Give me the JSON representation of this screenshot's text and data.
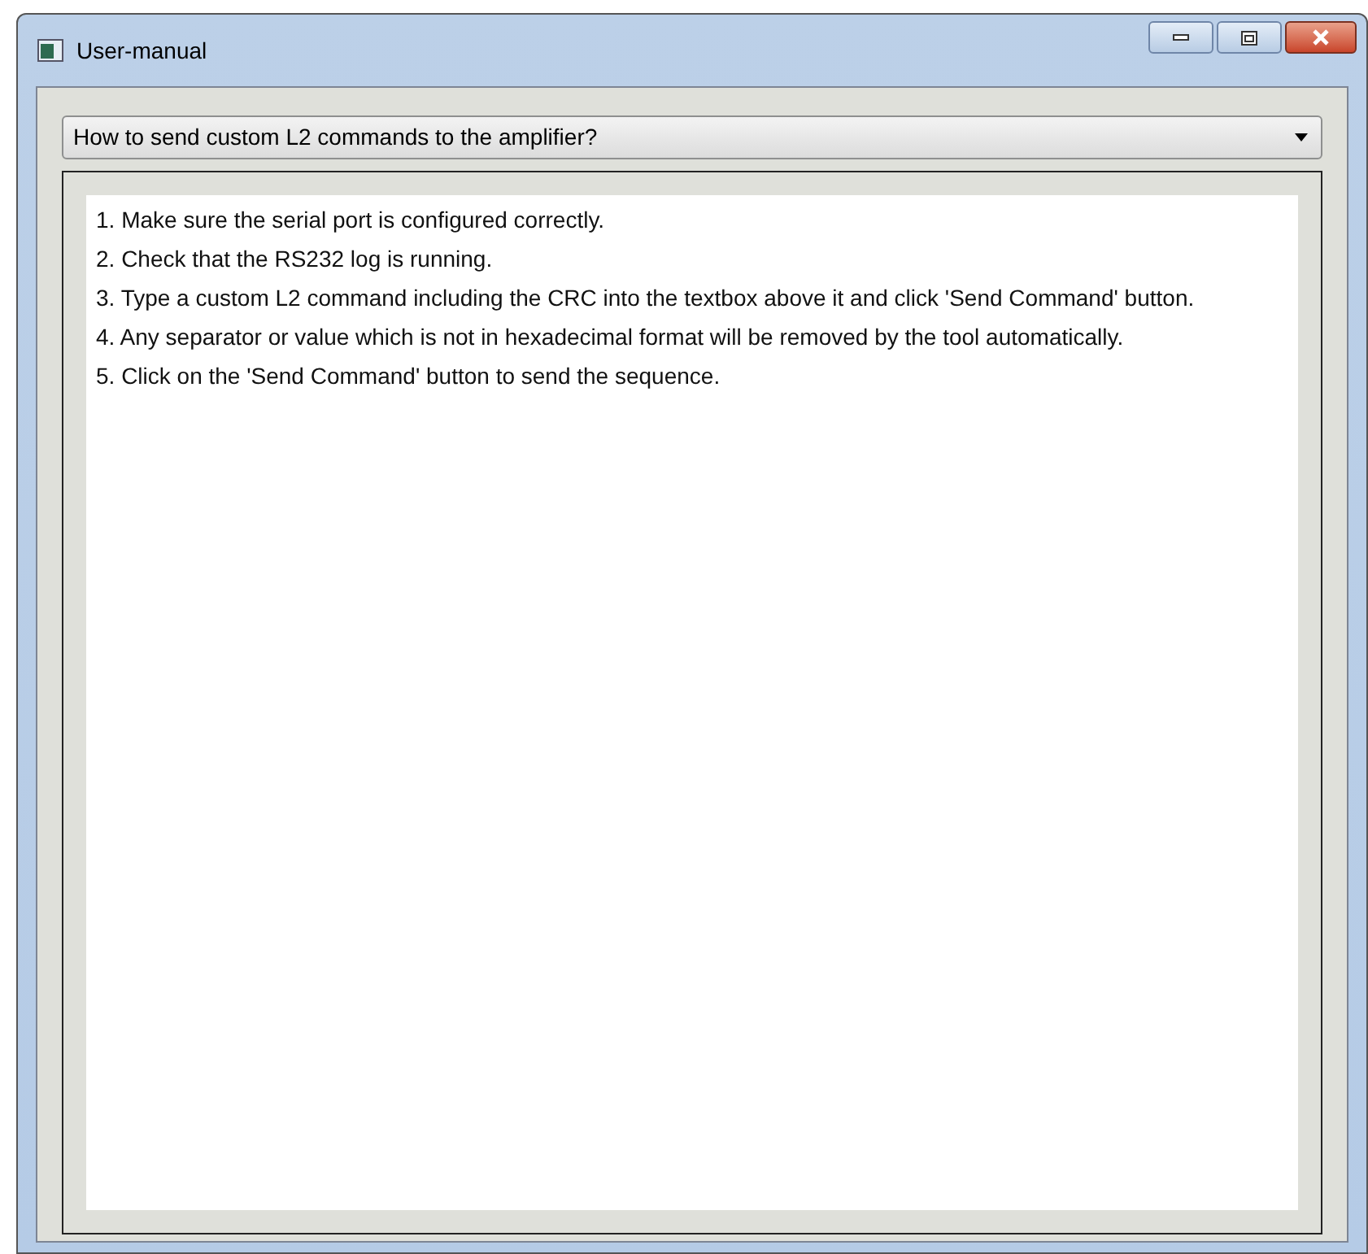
{
  "window": {
    "title": "User-manual"
  },
  "topic_dropdown": {
    "value": "How to send custom L2 commands to the amplifier?"
  },
  "steps": [
    "1. Make sure the serial port is configured correctly.",
    "2. Check that the RS232 log is running.",
    "3. Type a custom L2 command including the CRC into the textbox above it and click 'Send Command' button.",
    "4. Any separator or value which is not in hexadecimal format will be removed by the tool automatically.",
    "5. Click on the 'Send Command' button to send the sequence."
  ]
}
